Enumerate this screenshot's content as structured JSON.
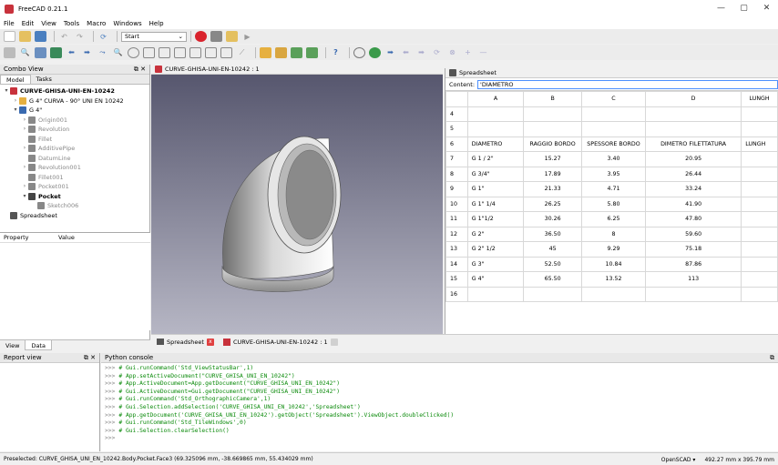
{
  "window": {
    "title": "FreeCAD 0.21.1",
    "controls": [
      "—",
      "▢",
      "✕"
    ]
  },
  "menu": [
    "File",
    "Edit",
    "View",
    "Tools",
    "Macro",
    "Windows",
    "Help"
  ],
  "toolbar": {
    "workbench": "Start"
  },
  "combo_view": {
    "title": "Combo View",
    "tabs": [
      "Model",
      "Tasks"
    ],
    "tree": [
      {
        "label": "CURVE-GHISA-UNI-EN-10242",
        "level": 0,
        "bold": true,
        "arrow": "▾"
      },
      {
        "label": "G 4\" CURVA - 90° UNI EN 10242",
        "level": 1,
        "arrow": "›"
      },
      {
        "label": "G 4\"",
        "level": 1,
        "arrow": "▾"
      },
      {
        "label": "Origin001",
        "level": 2,
        "arrow": "›",
        "grey": true
      },
      {
        "label": "Revolution",
        "level": 2,
        "arrow": "›",
        "grey": true
      },
      {
        "label": "Fillet",
        "level": 2,
        "arrow": "",
        "grey": true
      },
      {
        "label": "AdditivePipe",
        "level": 2,
        "arrow": "›",
        "grey": true
      },
      {
        "label": "DatumLine",
        "level": 2,
        "arrow": "",
        "grey": true
      },
      {
        "label": "Revolution001",
        "level": 2,
        "arrow": "›",
        "grey": true
      },
      {
        "label": "Fillet001",
        "level": 2,
        "arrow": "",
        "grey": true
      },
      {
        "label": "Pocket001",
        "level": 2,
        "arrow": "›",
        "grey": true
      },
      {
        "label": "Pocket",
        "level": 2,
        "arrow": "▾",
        "bold": true
      },
      {
        "label": "Sketch006",
        "level": 3,
        "arrow": "",
        "grey": true
      },
      {
        "label": "Spreadsheet",
        "level": 0,
        "arrow": ""
      }
    ],
    "property_headers": [
      "Property",
      "Value"
    ],
    "footer_tabs": [
      "View",
      "Data"
    ]
  },
  "viewport": {
    "tab_title": "CURVE-GHISA-UNI-EN-10242 : 1"
  },
  "spreadsheet": {
    "title": "Spreadsheet",
    "content_label": "Content:",
    "content_value": "'DIAMETRO",
    "columns": [
      "A",
      "B",
      "C",
      "D",
      "LUNGH"
    ],
    "rows": [
      {
        "n": "4",
        "cells": [
          "",
          "",
          "",
          "",
          ""
        ]
      },
      {
        "n": "5",
        "cells": [
          "",
          "",
          "",
          "",
          ""
        ]
      },
      {
        "n": "6",
        "cells": [
          "DIAMETRO",
          "RAGGIO BORDO",
          "SPESSORE BORDO",
          "DIMETRO FILETTATURA",
          "LUNGH"
        ]
      },
      {
        "n": "7",
        "cells": [
          "G 1 / 2\"",
          "15.27",
          "3.40",
          "20.95",
          ""
        ]
      },
      {
        "n": "8",
        "cells": [
          "G 3/4\"",
          "17.89",
          "3.95",
          "26.44",
          ""
        ]
      },
      {
        "n": "9",
        "cells": [
          "G 1\"",
          "21.33",
          "4.71",
          "33.24",
          ""
        ]
      },
      {
        "n": "10",
        "cells": [
          "G 1\" 1/4",
          "26.25",
          "5.80",
          "41.90",
          ""
        ]
      },
      {
        "n": "11",
        "cells": [
          "G 1\"1/2",
          "30.26",
          "6.25",
          "47.80",
          ""
        ]
      },
      {
        "n": "12",
        "cells": [
          "G 2\"",
          "36.50",
          "8",
          "59.60",
          ""
        ]
      },
      {
        "n": "13",
        "cells": [
          "G 2\" 1/2",
          "45",
          "9.29",
          "75.18",
          ""
        ]
      },
      {
        "n": "14",
        "cells": [
          "G 3\"",
          "52.50",
          "10.84",
          "87.86",
          ""
        ]
      },
      {
        "n": "15",
        "cells": [
          "G 4\"",
          "65.50",
          "13.52",
          "113",
          ""
        ]
      },
      {
        "n": "16",
        "cells": [
          "",
          "",
          "",
          "",
          ""
        ]
      }
    ]
  },
  "doc_tabs": [
    "Spreadsheet",
    "CURVE-GHISA-UNI-EN-10242 : 1"
  ],
  "report_view": {
    "title": "Report view"
  },
  "python_console": {
    "title": "Python console",
    "prompt": ">>>",
    "lines": [
      "# Gui.runCommand('Std_ViewStatusBar',1)",
      "# App.setActiveDocument(\"CURVE_GHISA_UNI_EN_10242\")",
      "# App.ActiveDocument=App.getDocument(\"CURVE_GHISA_UNI_EN_10242\")",
      "# Gui.ActiveDocument=Gui.getDocument(\"CURVE_GHISA_UNI_EN_10242\")",
      "# Gui.runCommand('Std_OrthographicCamera',1)",
      "# Gui.Selection.addSelection('CURVE_GHISA_UNI_EN_10242','Spreadsheet')",
      "# App.getDocument('CURVE_GHISA_UNI_EN_10242').getObject('Spreadsheet').ViewObject.doubleClicked()",
      "# Gui.runCommand('Std_TileWindows',0)",
      "# Gui.Selection.clearSelection()",
      ""
    ]
  },
  "statusbar": {
    "message": "Preselected: CURVE_GHISA_UNI_EN_10242.Body.Pocket.Face3 (69.325096 mm, -38.669865 mm, 55.434029 mm)",
    "navigation": "OpenSCAD ▾",
    "dimensions": "492.27 mm x 395.79 mm"
  }
}
